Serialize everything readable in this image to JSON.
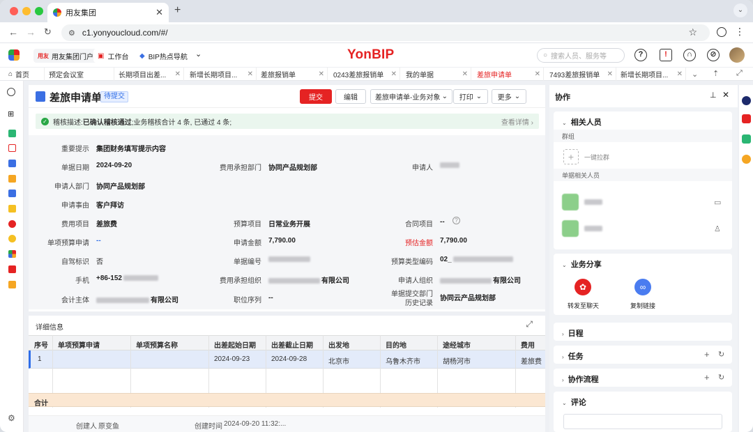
{
  "browser": {
    "tab_title": "用友集团",
    "url": "c1.yonyoucloud.com/#/"
  },
  "app": {
    "chips": [
      "用友集团门户",
      "工作台",
      "BIP热点导航"
    ],
    "logo": "YonBIP",
    "search_placeholder": "搜索人员、服务等"
  },
  "page_tabs": [
    "首页",
    "预定会议室",
    "长期项目出差...",
    "新增长期项目...",
    "差旅报销单",
    "0243差旅报销单",
    "我的单据",
    "差旅申请单",
    "7493差旅报销单",
    "新增长期项目..."
  ],
  "active_tab": "差旅申请单",
  "doc": {
    "title": "差旅申请单",
    "status": "待提交",
    "buttons": {
      "submit": "提交",
      "edit": "编辑",
      "type_select": "差旅申请单-业务对象",
      "print": "打印",
      "more": "更多"
    },
    "alert": {
      "prefix": "稽核描述:",
      "bold": "已确认稽核通过",
      "rest": ";业务稽核合计 4 条, 已通过 4 条;",
      "link": "查看详情"
    }
  },
  "fields": {
    "tip_label": "重要提示",
    "tip_value": "集团财务填写提示内容",
    "date_label": "单据日期",
    "date_value": "2024-09-20",
    "dept_label": "费用承担部门",
    "dept_value": "协同产品规划部",
    "applicant_label": "申请人",
    "applicant_dept_label": "申请人部门",
    "applicant_dept_value": "协同产品规划部",
    "reason_label": "申请事由",
    "reason_value": "客户拜访",
    "item_label": "费用项目",
    "item_value": "差旅费",
    "budget_item_label": "预算项目",
    "budget_item_value": "日常业务开展",
    "contract_label": "合同项目",
    "contract_value": "--",
    "single_budget_label": "单项预算申请",
    "single_budget_value": "--",
    "amount_label": "申请金额",
    "amount_value": "7,790.00",
    "est_label": "预估金额",
    "est_value": "7,790.00",
    "self_drive_label": "自驾标识",
    "self_drive_value": "否",
    "doc_no_label": "单据编号",
    "budget_type_label": "预算类型编码",
    "budget_type_value": "02_",
    "phone_label": "手机",
    "phone_value": "+86-152",
    "cost_org_label": "费用承担组织",
    "cost_org_suffix": "有限公司",
    "applicant_org_label": "申请人组织",
    "applicant_org_suffix": "有限公司",
    "entity_label": "会计主体",
    "entity_suffix": "有限公司",
    "position_label": "职位序列",
    "position_value": "--",
    "history_label1": "单据提交部门",
    "history_label2": "历史记录",
    "history_value": "协同云产品规划部"
  },
  "detail": {
    "title": "详细信息",
    "columns": [
      "序号",
      "单项预算申请",
      "单项预算名称",
      "出差起始日期",
      "出差截止日期",
      "出发地",
      "目的地",
      "途经城市",
      "费用"
    ],
    "rows": [
      [
        "1",
        "",
        "",
        "2024-09-23",
        "2024-09-28",
        "北京市",
        "乌鲁木齐市",
        "胡杨河市",
        "差旅费"
      ]
    ],
    "sum_label": "合计"
  },
  "footer": {
    "creator_label": "创建人",
    "creator": "原变鱼",
    "created_label": "创建时间",
    "created_time": "2024-09-20 11:32:..."
  },
  "collab": {
    "title": "协作",
    "people": "相关人员",
    "group": "群组",
    "pull_group": "一键拉群",
    "doc_people": "单据相关人员",
    "share": "业务分享",
    "share_chat": "转发至聊天",
    "copy_link": "复制链接",
    "schedule": "日程",
    "task": "任务",
    "flow": "协作流程",
    "comment": "评论"
  },
  "colors": {
    "brand": "#e52323",
    "primary": "#2f6ee8",
    "success": "#28a745"
  }
}
